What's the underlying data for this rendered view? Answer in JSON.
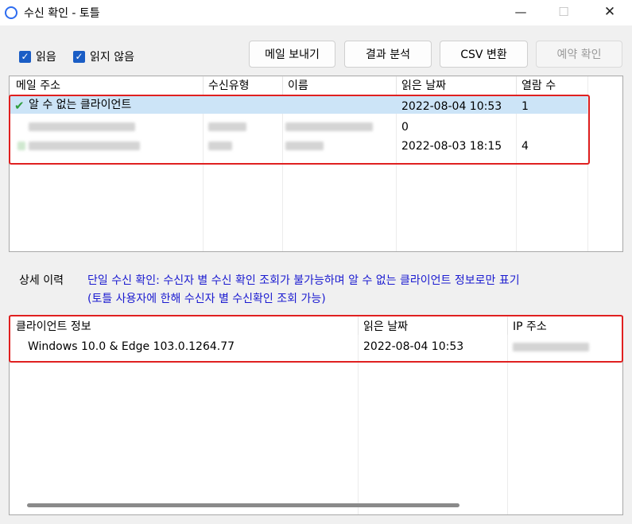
{
  "window": {
    "title": "수신 확인 - 토틀",
    "minimize_glyph": "—",
    "maximize_glyph": "☐",
    "close_glyph": "✕"
  },
  "filters": {
    "read_label": "읽음",
    "unread_label": "읽지 않음",
    "check_glyph": "✓"
  },
  "toolbar": {
    "send_mail": "메일 보내기",
    "analyze": "결과 분석",
    "csv_convert": "CSV 변환",
    "reservation": "예약 확인"
  },
  "recipients": {
    "columns": [
      "메일 주소",
      "수신유형",
      "이름",
      "읽은 날짜",
      "열람 수"
    ],
    "rows": [
      {
        "email": "알 수 없는 클라이언트",
        "type": "",
        "name": "",
        "read_date": "2022-08-04 10:53",
        "views": "1",
        "selected": true,
        "check_glyph": "✔"
      },
      {
        "email": "",
        "type": "",
        "name": "",
        "read_date": "",
        "views": "0"
      },
      {
        "email": "",
        "type": "",
        "name": "",
        "read_date": "2022-08-03 18:15",
        "views": "4"
      }
    ]
  },
  "detail": {
    "label": "상세 이력",
    "message_line1": "단일 수신 확인: 수신자 별 수신 확인 조회가 불가능하며 알 수 없는 클라이언트 정보로만 표기",
    "message_line2": "(토틀 사용자에 한해 수신자 별 수신확인 조회 가능)"
  },
  "clients": {
    "columns": [
      "클라이언트 정보",
      "읽은 날짜",
      "IP 주소"
    ],
    "rows": [
      {
        "client": "Windows 10.0 & Edge 103.0.1264.77",
        "read_date": "2022-08-04 10:53",
        "ip": ""
      }
    ]
  },
  "colors": {
    "accent": "#1a5dc5",
    "highlight_border": "#e02020",
    "selection": "#cce4f7",
    "info_text": "#1a1ad0",
    "check_green": "#2e9e3e"
  }
}
